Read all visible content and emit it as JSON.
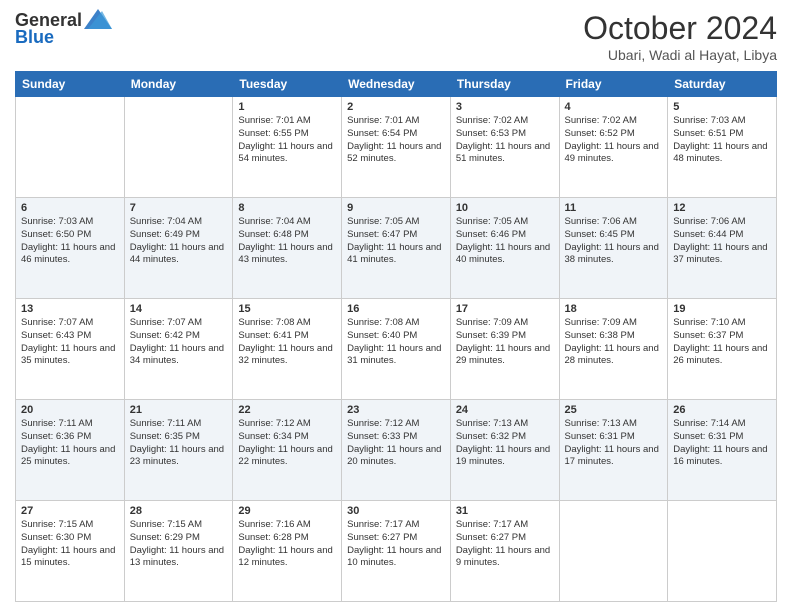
{
  "header": {
    "logo": {
      "text_general": "General",
      "text_blue": "Blue"
    },
    "month": "October 2024",
    "location": "Ubari, Wadi al Hayat, Libya"
  },
  "weekdays": [
    "Sunday",
    "Monday",
    "Tuesday",
    "Wednesday",
    "Thursday",
    "Friday",
    "Saturday"
  ],
  "weeks": [
    [
      {
        "day": "",
        "sunrise": "",
        "sunset": "",
        "daylight": ""
      },
      {
        "day": "",
        "sunrise": "",
        "sunset": "",
        "daylight": ""
      },
      {
        "day": "1",
        "sunrise": "Sunrise: 7:01 AM",
        "sunset": "Sunset: 6:55 PM",
        "daylight": "Daylight: 11 hours and 54 minutes."
      },
      {
        "day": "2",
        "sunrise": "Sunrise: 7:01 AM",
        "sunset": "Sunset: 6:54 PM",
        "daylight": "Daylight: 11 hours and 52 minutes."
      },
      {
        "day": "3",
        "sunrise": "Sunrise: 7:02 AM",
        "sunset": "Sunset: 6:53 PM",
        "daylight": "Daylight: 11 hours and 51 minutes."
      },
      {
        "day": "4",
        "sunrise": "Sunrise: 7:02 AM",
        "sunset": "Sunset: 6:52 PM",
        "daylight": "Daylight: 11 hours and 49 minutes."
      },
      {
        "day": "5",
        "sunrise": "Sunrise: 7:03 AM",
        "sunset": "Sunset: 6:51 PM",
        "daylight": "Daylight: 11 hours and 48 minutes."
      }
    ],
    [
      {
        "day": "6",
        "sunrise": "Sunrise: 7:03 AM",
        "sunset": "Sunset: 6:50 PM",
        "daylight": "Daylight: 11 hours and 46 minutes."
      },
      {
        "day": "7",
        "sunrise": "Sunrise: 7:04 AM",
        "sunset": "Sunset: 6:49 PM",
        "daylight": "Daylight: 11 hours and 44 minutes."
      },
      {
        "day": "8",
        "sunrise": "Sunrise: 7:04 AM",
        "sunset": "Sunset: 6:48 PM",
        "daylight": "Daylight: 11 hours and 43 minutes."
      },
      {
        "day": "9",
        "sunrise": "Sunrise: 7:05 AM",
        "sunset": "Sunset: 6:47 PM",
        "daylight": "Daylight: 11 hours and 41 minutes."
      },
      {
        "day": "10",
        "sunrise": "Sunrise: 7:05 AM",
        "sunset": "Sunset: 6:46 PM",
        "daylight": "Daylight: 11 hours and 40 minutes."
      },
      {
        "day": "11",
        "sunrise": "Sunrise: 7:06 AM",
        "sunset": "Sunset: 6:45 PM",
        "daylight": "Daylight: 11 hours and 38 minutes."
      },
      {
        "day": "12",
        "sunrise": "Sunrise: 7:06 AM",
        "sunset": "Sunset: 6:44 PM",
        "daylight": "Daylight: 11 hours and 37 minutes."
      }
    ],
    [
      {
        "day": "13",
        "sunrise": "Sunrise: 7:07 AM",
        "sunset": "Sunset: 6:43 PM",
        "daylight": "Daylight: 11 hours and 35 minutes."
      },
      {
        "day": "14",
        "sunrise": "Sunrise: 7:07 AM",
        "sunset": "Sunset: 6:42 PM",
        "daylight": "Daylight: 11 hours and 34 minutes."
      },
      {
        "day": "15",
        "sunrise": "Sunrise: 7:08 AM",
        "sunset": "Sunset: 6:41 PM",
        "daylight": "Daylight: 11 hours and 32 minutes."
      },
      {
        "day": "16",
        "sunrise": "Sunrise: 7:08 AM",
        "sunset": "Sunset: 6:40 PM",
        "daylight": "Daylight: 11 hours and 31 minutes."
      },
      {
        "day": "17",
        "sunrise": "Sunrise: 7:09 AM",
        "sunset": "Sunset: 6:39 PM",
        "daylight": "Daylight: 11 hours and 29 minutes."
      },
      {
        "day": "18",
        "sunrise": "Sunrise: 7:09 AM",
        "sunset": "Sunset: 6:38 PM",
        "daylight": "Daylight: 11 hours and 28 minutes."
      },
      {
        "day": "19",
        "sunrise": "Sunrise: 7:10 AM",
        "sunset": "Sunset: 6:37 PM",
        "daylight": "Daylight: 11 hours and 26 minutes."
      }
    ],
    [
      {
        "day": "20",
        "sunrise": "Sunrise: 7:11 AM",
        "sunset": "Sunset: 6:36 PM",
        "daylight": "Daylight: 11 hours and 25 minutes."
      },
      {
        "day": "21",
        "sunrise": "Sunrise: 7:11 AM",
        "sunset": "Sunset: 6:35 PM",
        "daylight": "Daylight: 11 hours and 23 minutes."
      },
      {
        "day": "22",
        "sunrise": "Sunrise: 7:12 AM",
        "sunset": "Sunset: 6:34 PM",
        "daylight": "Daylight: 11 hours and 22 minutes."
      },
      {
        "day": "23",
        "sunrise": "Sunrise: 7:12 AM",
        "sunset": "Sunset: 6:33 PM",
        "daylight": "Daylight: 11 hours and 20 minutes."
      },
      {
        "day": "24",
        "sunrise": "Sunrise: 7:13 AM",
        "sunset": "Sunset: 6:32 PM",
        "daylight": "Daylight: 11 hours and 19 minutes."
      },
      {
        "day": "25",
        "sunrise": "Sunrise: 7:13 AM",
        "sunset": "Sunset: 6:31 PM",
        "daylight": "Daylight: 11 hours and 17 minutes."
      },
      {
        "day": "26",
        "sunrise": "Sunrise: 7:14 AM",
        "sunset": "Sunset: 6:31 PM",
        "daylight": "Daylight: 11 hours and 16 minutes."
      }
    ],
    [
      {
        "day": "27",
        "sunrise": "Sunrise: 7:15 AM",
        "sunset": "Sunset: 6:30 PM",
        "daylight": "Daylight: 11 hours and 15 minutes."
      },
      {
        "day": "28",
        "sunrise": "Sunrise: 7:15 AM",
        "sunset": "Sunset: 6:29 PM",
        "daylight": "Daylight: 11 hours and 13 minutes."
      },
      {
        "day": "29",
        "sunrise": "Sunrise: 7:16 AM",
        "sunset": "Sunset: 6:28 PM",
        "daylight": "Daylight: 11 hours and 12 minutes."
      },
      {
        "day": "30",
        "sunrise": "Sunrise: 7:17 AM",
        "sunset": "Sunset: 6:27 PM",
        "daylight": "Daylight: 11 hours and 10 minutes."
      },
      {
        "day": "31",
        "sunrise": "Sunrise: 7:17 AM",
        "sunset": "Sunset: 6:27 PM",
        "daylight": "Daylight: 11 hours and 9 minutes."
      },
      {
        "day": "",
        "sunrise": "",
        "sunset": "",
        "daylight": ""
      },
      {
        "day": "",
        "sunrise": "",
        "sunset": "",
        "daylight": ""
      }
    ]
  ]
}
